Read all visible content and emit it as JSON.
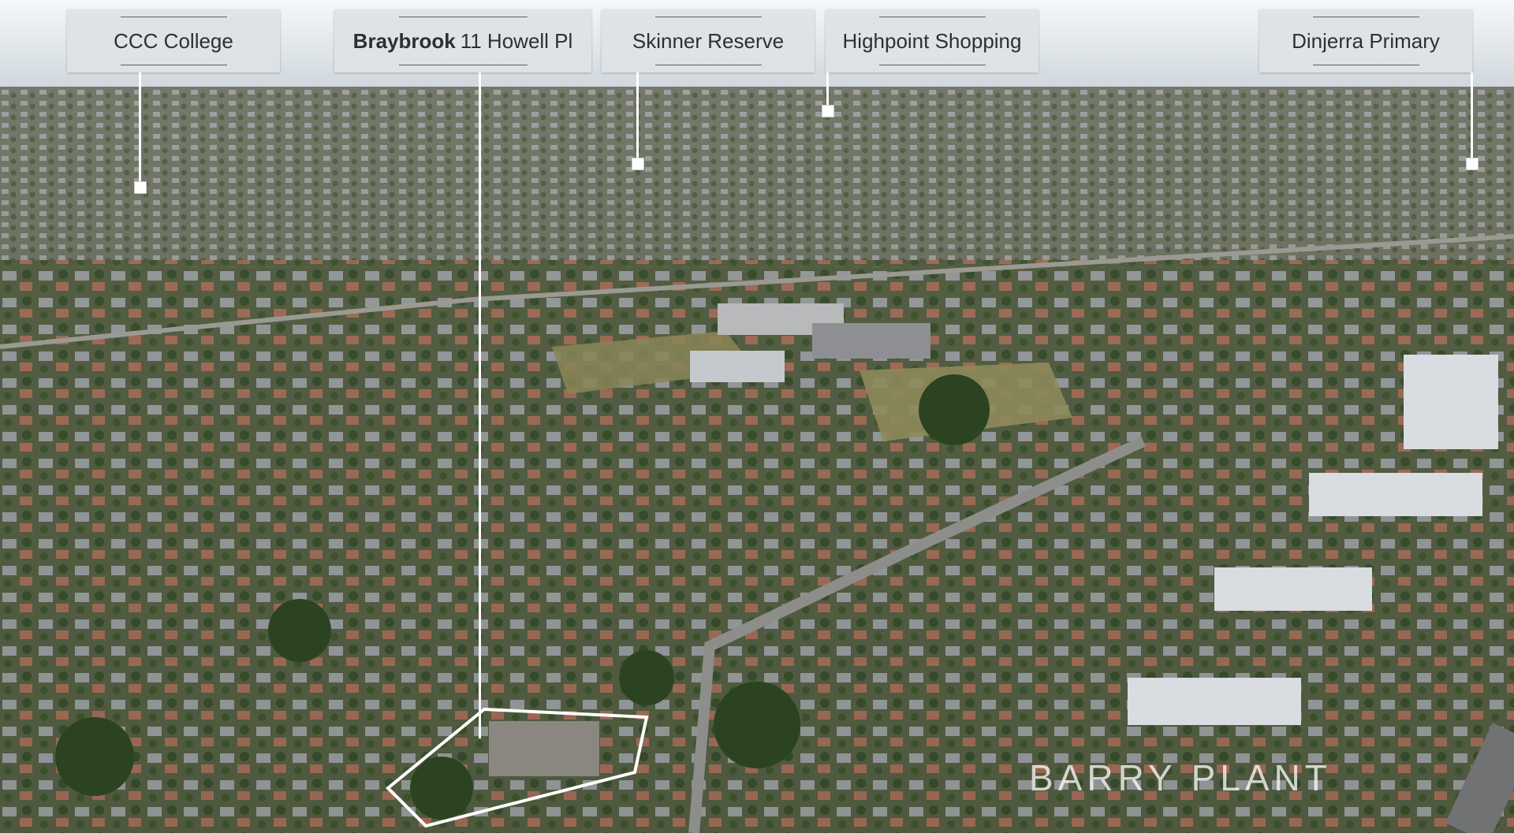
{
  "labels": {
    "ccc": "CCC College",
    "braybrook_bold": "Braybrook",
    "braybrook_rest": "11 Howell Pl",
    "skinner": "Skinner Reserve",
    "highpoint": "Highpoint Shopping",
    "dinjerra": "Dinjerra Primary"
  },
  "watermark": "BARRY PLANT",
  "colors": {
    "sky": "#e9eef2",
    "vegetation": "#3f5a2c",
    "roofs": "#8a8f96",
    "outline": "#ffffff"
  }
}
